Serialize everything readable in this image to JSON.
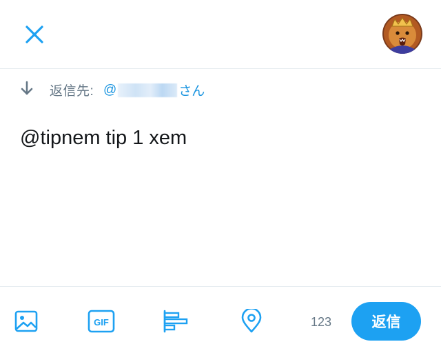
{
  "header": {
    "close_icon": "close-icon",
    "avatar_icon": "lion-avatar"
  },
  "reply_context": {
    "arrow_icon": "arrow-down-icon",
    "label": "返信先:",
    "at_sign": "@",
    "suffix": "さん"
  },
  "compose": {
    "text": "@tipnem tip 1 xem"
  },
  "toolbar": {
    "icons": [
      "image-icon",
      "gif-icon",
      "poll-icon",
      "location-icon"
    ],
    "gif_label": "GIF",
    "char_count": "123",
    "reply_label": "返信"
  },
  "colors": {
    "accent": "#1da1f2",
    "link": "#1b95e0",
    "muted": "#657786",
    "text": "#14171a"
  }
}
